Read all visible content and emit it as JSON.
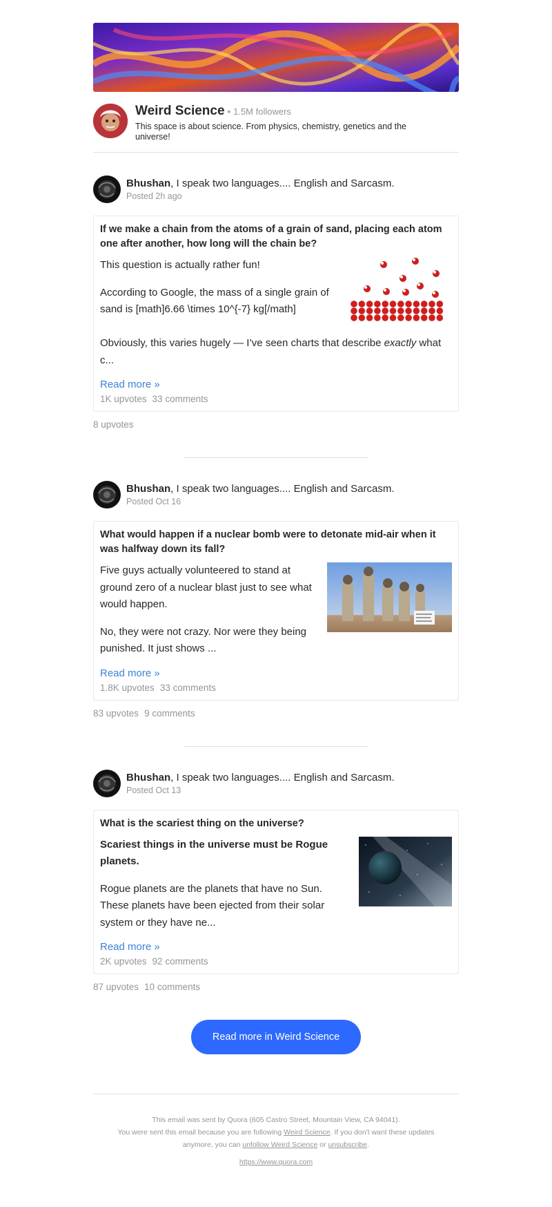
{
  "space": {
    "name": "Weird Science",
    "dot": "•",
    "followers": "1.5M followers",
    "description": "This space is about science. From physics, chemistry, genetics and the universe!"
  },
  "posts": [
    {
      "author_name": "Bhushan",
      "author_tagline": ", I speak two languages.... English and Sarcasm.",
      "posted": "Posted 2h ago",
      "question": "If we make a chain from the atoms of a grain of sand, placing each atom one after another, how long will the chain be?",
      "paragraphs": [
        "This question is actually rather fun!",
        "According to Google, the mass of a single grain of sand is [math]6.66 \\times 10^{-7} kg[/math]"
      ],
      "p3_before": "Obviously, this varies hugely — I’ve seen charts that describe ",
      "p3_emph": "exactly",
      "p3_after": " what c...",
      "read_more": "Read more »",
      "card_upvotes": "1K upvotes",
      "card_comments": "33 comments",
      "upvotes": "8 upvotes",
      "comments": ""
    },
    {
      "author_name": "Bhushan",
      "author_tagline": ", I speak two languages.... English and Sarcasm.",
      "posted": "Posted Oct 16",
      "question": "What would happen if a nuclear bomb were to detonate mid-air when it was halfway down its fall?",
      "paragraphs": [
        "Five guys actually volunteered to stand at ground zero of a nuclear blast just to see what would happen.",
        "No, they were not crazy. Nor were they being punished. It just shows ..."
      ],
      "read_more": "Read more »",
      "card_upvotes": "1.8K upvotes",
      "card_comments": "33 comments",
      "upvotes": "83 upvotes",
      "comments": "9 comments"
    },
    {
      "author_name": "Bhushan",
      "author_tagline": ", I speak two languages.... English and Sarcasm.",
      "posted": "Posted Oct 13",
      "question": "What is the scariest thing on the universe?",
      "headline": "Scariest things in the universe must be Rogue planets.",
      "paragraphs": [
        "Rogue planets are the planets that have no Sun. These planets have been ejected from their solar system or they have ne..."
      ],
      "read_more": "Read more »",
      "card_upvotes": "2K upvotes",
      "card_comments": "92 comments",
      "upvotes": "87 upvotes",
      "comments": "10 comments"
    }
  ],
  "cta": "Read more in Weird Science",
  "footer": {
    "line1": "This email was sent by Quora (605 Castro Street, Mountain View, CA 94041).",
    "line2_a": "You were sent this email because you are following ",
    "line2_link": "Weird Science",
    "line2_b": ". If you don't want these updates",
    "line3_a": "anymore, you can ",
    "unfollow": "unfollow Weird Science",
    "line3_b": " or ",
    "unsubscribe": "unsubscribe",
    "line3_c": ".",
    "site": "https://www.quora.com"
  }
}
